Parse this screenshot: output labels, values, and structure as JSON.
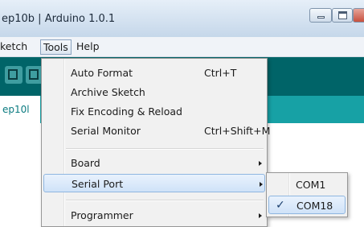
{
  "window": {
    "title": "ep10b | Arduino 1.0.1"
  },
  "menubar": {
    "sketch": "ketch",
    "tools": "Tools",
    "help": "Help"
  },
  "editor": {
    "tab_label": "ep10l"
  },
  "tools_menu": {
    "items": [
      {
        "label": "Auto Format",
        "shortcut": "Ctrl+T"
      },
      {
        "label": "Archive Sketch",
        "shortcut": ""
      },
      {
        "label": "Fix Encoding & Reload",
        "shortcut": ""
      },
      {
        "label": "Serial Monitor",
        "shortcut": "Ctrl+Shift+M"
      },
      {
        "label": "Board",
        "shortcut": ""
      },
      {
        "label": "Serial Port",
        "shortcut": ""
      },
      {
        "label": "Programmer",
        "shortcut": ""
      }
    ]
  },
  "serial_port_menu": {
    "items": [
      {
        "label": "COM1",
        "checked": false
      },
      {
        "label": "COM18",
        "checked": true
      }
    ],
    "check_glyph": "✓"
  },
  "colors": {
    "toolbar": "#006468",
    "tabstrip": "#17a1a5",
    "menu_highlight": "#cfe2f8"
  },
  "icons": [
    "minimize-icon",
    "maximize-icon",
    "close-icon",
    "submenu-arrow-icon",
    "checkmark-icon",
    "toolbar-button-icon"
  ]
}
